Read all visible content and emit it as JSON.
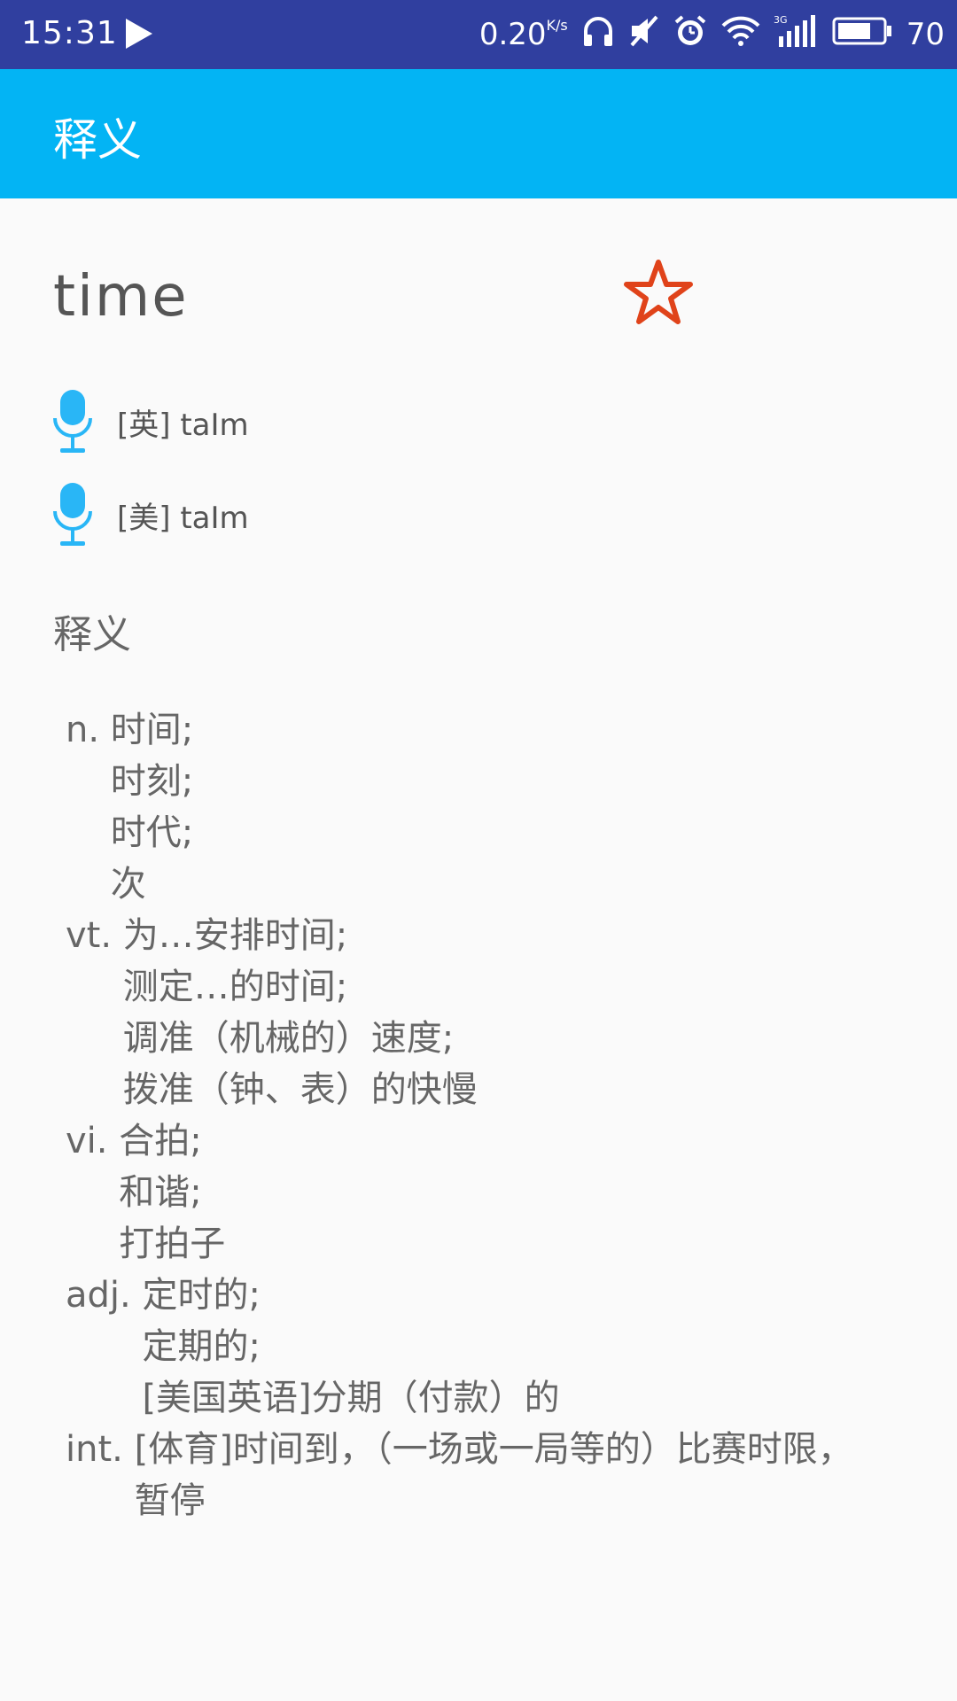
{
  "status_bar": {
    "time": "15:31",
    "network_speed": "0.20",
    "network_unit": "K/s",
    "network_type": "3G",
    "battery": "70",
    "icons": [
      "play-icon",
      "headphones-icon",
      "mute-icon",
      "alarm-icon",
      "wifi-icon",
      "signal-icon",
      "battery-icon"
    ]
  },
  "toolbar": {
    "title": "释义"
  },
  "word": {
    "text": "time",
    "favorite_icon": "star-outline-icon",
    "favorite_color": "#e0431a"
  },
  "pronunciations": [
    {
      "label": "[英] taIm",
      "icon": "microphone-icon"
    },
    {
      "label": "[美] taIm",
      "icon": "microphone-icon"
    }
  ],
  "section_title": "释义",
  "definitions": [
    {
      "pos": "n.",
      "meanings": [
        "时间;",
        "时刻;",
        "时代;",
        "次"
      ]
    },
    {
      "pos": "vt.",
      "meanings": [
        "为…安排时间;",
        "测定…的时间;",
        "调准（机械的）速度;",
        "拨准（钟、表）的快慢"
      ]
    },
    {
      "pos": "vi.",
      "meanings": [
        "合拍;",
        "和谐;",
        "打拍子"
      ]
    },
    {
      "pos": "adj.",
      "meanings": [
        "定时的;",
        "定期的;",
        "[美国英语]分期（付款）的"
      ]
    },
    {
      "pos": "int.",
      "meanings": [
        "[体育]时间到，（一场或一局等的）比赛时限，",
        "暂停"
      ]
    }
  ],
  "colors": {
    "status_bar": "#303f9f",
    "toolbar": "#03b4f4",
    "mic": "#29b6f6"
  }
}
